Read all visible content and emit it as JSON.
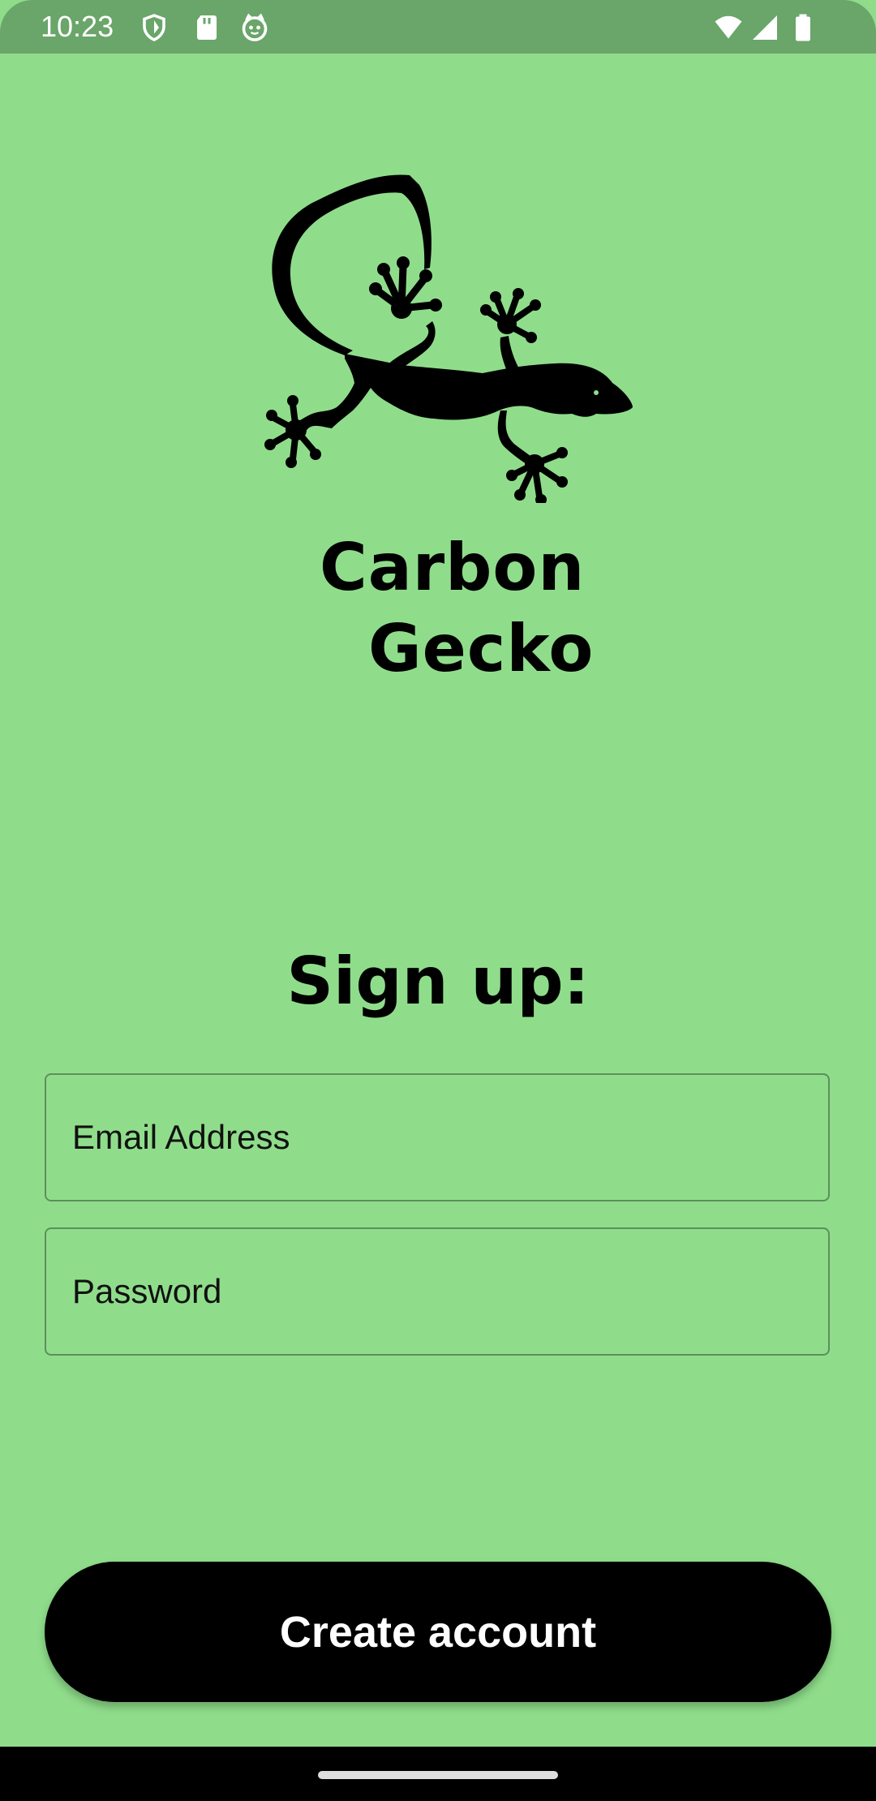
{
  "status_bar": {
    "time": "10:23",
    "left_icons": [
      "shield-icon",
      "sd-card-icon",
      "cat-face-icon"
    ],
    "right_icons": [
      "wifi-icon",
      "cellular-signal-icon",
      "battery-icon"
    ]
  },
  "app": {
    "logo": "gecko-icon",
    "title_line_1": "Carbon",
    "title_line_2": "Gecko"
  },
  "signup": {
    "heading": "Sign up:",
    "email_placeholder": "Email Address",
    "email_value": "",
    "password_placeholder": "Password",
    "password_value": "",
    "submit_label": "Create account"
  },
  "colors": {
    "background": "#8fdd8b",
    "status_bar": "#6aa56a",
    "button": "#000000",
    "button_text": "#ffffff",
    "field_border": "#5c8f5c"
  }
}
